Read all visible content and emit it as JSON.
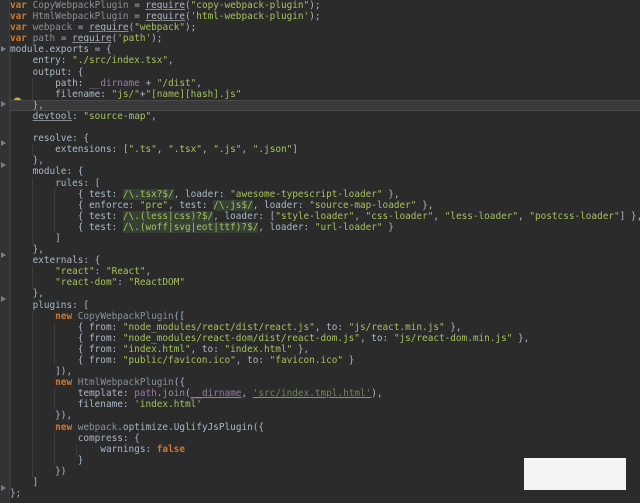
{
  "editor": {
    "language": "javascript",
    "file": "webpack.config.js",
    "colors": {
      "background": "#2b2b2b",
      "keyword": "#cc7832",
      "string": "#a5c25c",
      "identifier": "#a9b7c6",
      "property": "#9876aa",
      "function": "#ffc66d",
      "gutter": "#313335"
    },
    "current_line": 10,
    "intention_icon": "lightbulb-icon"
  },
  "lines": [
    [
      "var",
      " ",
      "CopyWebpackPlugin",
      " = ",
      "require",
      "(",
      "\"copy-webpack-plugin\"",
      ");"
    ],
    [
      "var",
      " ",
      "HtmlWebpackPlugin",
      " = ",
      "require",
      "(",
      "'html-webpack-plugin'",
      ");"
    ],
    [
      "var",
      " ",
      "webpack",
      " = ",
      "require",
      "(",
      "\"webpack\"",
      ");"
    ],
    [
      "var",
      " ",
      "path",
      " = ",
      "require",
      "(",
      "'path'",
      ");"
    ],
    [
      "module.exports = {"
    ],
    [
      "    entry: ",
      "\"./src/index.tsx\"",
      ","
    ],
    [
      "    output: {"
    ],
    [
      "        path: ",
      "__dirname",
      " + ",
      "\"/dist\"",
      ","
    ],
    [
      "        filename: ",
      "\"js/\"",
      "+",
      "\"[name][hash].js\""
    ],
    [
      "    },"
    ],
    [
      "    ",
      "devtool",
      ": ",
      "\"source-map\"",
      ","
    ],
    [
      ""
    ],
    [
      "    resolve: {"
    ],
    [
      "        extensions: [",
      "\".ts\"",
      ", ",
      "\".tsx\"",
      ", ",
      "\".js\"",
      ", ",
      "\".json\"",
      "]"
    ],
    [
      "    },"
    ],
    [
      "    module: {"
    ],
    [
      "        rules: ["
    ],
    [
      "            { test: ",
      "/\\.tsx?$/",
      ", loader: ",
      "\"awesome-typescript-loader\"",
      " },"
    ],
    [
      "            { enforce: ",
      "\"pre\"",
      ", test: ",
      "/\\.js$/",
      ", loader: ",
      "\"source-map-loader\"",
      " },"
    ],
    [
      "            { test: ",
      "/\\.(less|css)?$/",
      ", loader: [",
      "\"style-loader\"",
      ", ",
      "\"css-loader\"",
      ", ",
      "\"less-loader\"",
      ", ",
      "\"postcss-loader\"",
      "] },"
    ],
    [
      "            { test: ",
      "/\\.(woff|svg|eot|ttf)?$/",
      ", loader: ",
      "\"url-loader\"",
      " }"
    ],
    [
      "        ]"
    ],
    [
      "    },"
    ],
    [
      "    externals: {"
    ],
    [
      "        ",
      "\"react\"",
      ": ",
      "\"React\"",
      ","
    ],
    [
      "        ",
      "\"react-dom\"",
      ": ",
      "\"ReactDOM\""
    ],
    [
      "    },"
    ],
    [
      "    plugins: ["
    ],
    [
      "        ",
      "new",
      " ",
      "CopyWebpackPlugin",
      "(["
    ],
    [
      "            { from: ",
      "\"node_modules/react/dist/react.js\"",
      ", to: ",
      "\"js/react.min.js\"",
      " },"
    ],
    [
      "            { from: ",
      "\"node_modules/react-dom/dist/react-dom.js\"",
      ", to: ",
      "\"js/react-dom.min.js\"",
      " },"
    ],
    [
      "            { from: ",
      "\"index.html\"",
      ", to: ",
      "\"index.html\"",
      " },"
    ],
    [
      "            { from: ",
      "\"public/favicon.ico\"",
      ", to: ",
      "\"favicon.ico\"",
      " }"
    ],
    [
      "        ]),"
    ],
    [
      "        ",
      "new",
      " ",
      "HtmlWebpackPlugin",
      "({"
    ],
    [
      "            template: ",
      "path",
      ".",
      "join",
      "(",
      "__dirname",
      ", ",
      "'src/index.tmpl.html'",
      "),"
    ],
    [
      "            filename: ",
      "'index.html'"
    ],
    [
      "        }),"
    ],
    [
      "        ",
      "new",
      " ",
      "webpack",
      ".",
      "optimize",
      ".",
      "UglifyJsPlugin",
      "({"
    ],
    [
      "            compress: {"
    ],
    [
      "                warnings: ",
      "false"
    ],
    [
      "            }"
    ],
    [
      "        })"
    ],
    [
      "    ]"
    ],
    [
      "};"
    ]
  ]
}
